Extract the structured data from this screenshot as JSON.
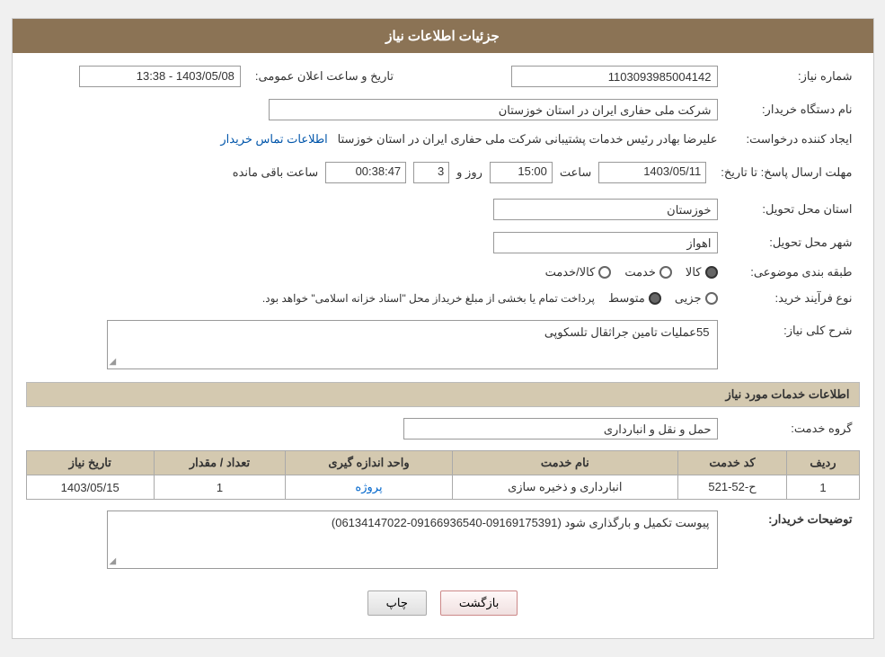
{
  "header": {
    "title": "جزئیات اطلاعات نیاز"
  },
  "fields": {
    "need_number_label": "شماره نیاز:",
    "need_number_value": "1103093985004142",
    "publish_datetime_label": "تاریخ و ساعت اعلان عمومی:",
    "publish_datetime_value": "1403/05/08 - 13:38",
    "buyer_org_label": "نام دستگاه خریدار:",
    "buyer_org_value": "شرکت ملی حفاری ایران در استان خوزستان",
    "requester_label": "ایجاد کننده درخواست:",
    "requester_value": "علیرضا بهادر رئیس خدمات پشتیبانی شرکت ملی حفاری ایران در استان خوزستا",
    "contact_link": "اطلاعات تماس خریدار",
    "deadline_label": "مهلت ارسال پاسخ: تا تاریخ:",
    "deadline_date": "1403/05/11",
    "deadline_time_label": "ساعت",
    "deadline_time": "15:00",
    "deadline_days_label": "روز و",
    "deadline_days": "3",
    "deadline_remaining_label": "ساعت باقی مانده",
    "deadline_remaining": "00:38:47",
    "province_label": "استان محل تحویل:",
    "province_value": "خوزستان",
    "city_label": "شهر محل تحویل:",
    "city_value": "اهواز",
    "category_label": "طبقه بندی موضوعی:",
    "category_options": [
      "کالا",
      "خدمت",
      "کالا/خدمت"
    ],
    "category_selected": "کالا",
    "purchase_type_label": "نوع فرآیند خرید:",
    "purchase_options": [
      "جزیی",
      "متوسط"
    ],
    "purchase_note": "پرداخت تمام یا بخشی از مبلغ خریداز محل \"اسناد خزانه اسلامی\" خواهد بود.",
    "need_description_label": "شرح کلی نیاز:",
    "need_description_value": "55عملیات تامین جراثقال تلسکوپی",
    "service_info_label": "اطلاعات خدمات مورد نیاز",
    "service_group_label": "گروه خدمت:",
    "service_group_value": "حمل و نقل و انبارداری"
  },
  "table": {
    "columns": [
      "ردیف",
      "کد خدمت",
      "نام خدمت",
      "واحد اندازه گیری",
      "تعداد / مقدار",
      "تاریخ نیاز"
    ],
    "rows": [
      {
        "row_num": "1",
        "service_code": "ح-52-521",
        "service_name": "انبارداری و ذخیره سازی",
        "unit": "پروژه",
        "quantity": "1",
        "date": "1403/05/15"
      }
    ]
  },
  "buyer_notes": {
    "label": "توضیحات خریدار:",
    "value": "پیوست تکمیل و بارگذاری شود (09169175391-09166936540-06134147022)"
  },
  "buttons": {
    "print": "چاپ",
    "back": "بازگشت"
  }
}
